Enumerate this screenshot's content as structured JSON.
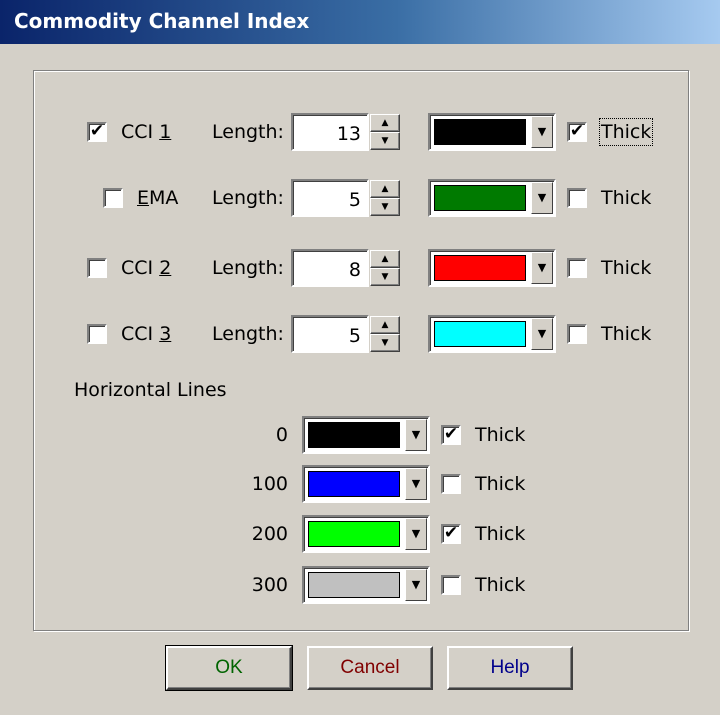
{
  "window": {
    "title": "Commodity Channel Index"
  },
  "indicators": [
    {
      "label_pre": "CCI ",
      "label_u": "1",
      "label_post": "",
      "checked": "✔",
      "length_label": "Length:",
      "length": "13",
      "color": "#000000",
      "thick_checked": "✔",
      "thick_label": "Thick"
    },
    {
      "label_pre": "",
      "label_u": "E",
      "label_post": "MA",
      "checked": "",
      "length_label": "Length:",
      "length": "5",
      "color": "#007a00",
      "thick_checked": "",
      "thick_label": "Thick"
    },
    {
      "label_pre": "CCI ",
      "label_u": "2",
      "label_post": "",
      "checked": "",
      "length_label": "Length:",
      "length": "8",
      "color": "#ff0000",
      "thick_checked": "",
      "thick_label": "Thick"
    },
    {
      "label_pre": "CCI ",
      "label_u": "3",
      "label_post": "",
      "checked": "",
      "length_label": "Length:",
      "length": "5",
      "color": "#00ffff",
      "thick_checked": "",
      "thick_label": "Thick"
    }
  ],
  "horizontal": {
    "title": "Horizontal Lines",
    "lines": [
      {
        "value": "0",
        "color": "#000000",
        "thick_checked": "✔",
        "thick_label": "Thick"
      },
      {
        "value": "100",
        "color": "#0000ff",
        "thick_checked": "",
        "thick_label": "Thick"
      },
      {
        "value": "200",
        "color": "#00ff00",
        "thick_checked": "✔",
        "thick_label": "Thick"
      },
      {
        "value": "300",
        "color": "#c0c0c0",
        "thick_checked": "",
        "thick_label": "Thick"
      }
    ]
  },
  "buttons": {
    "ok": "OK",
    "ok_color": "#006400",
    "cancel": "Cancel",
    "cancel_color": "#800000",
    "help": "Help",
    "help_color": "#00008b"
  },
  "icons": {
    "spin_up": "▲",
    "spin_down": "▼",
    "dropdown": "▼"
  }
}
